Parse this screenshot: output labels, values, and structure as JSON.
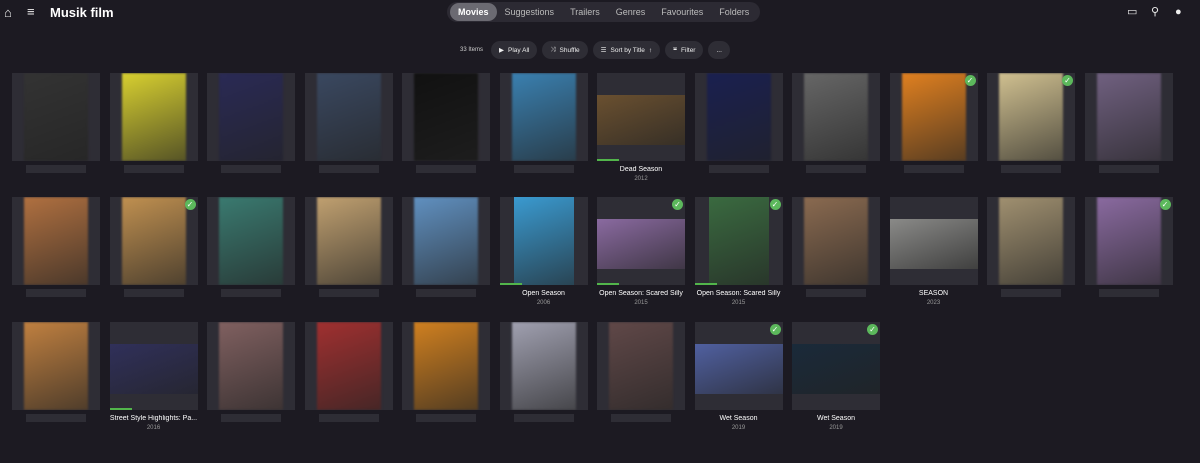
{
  "header": {
    "title": "Musik film",
    "tabs": [
      "Movies",
      "Suggestions",
      "Trailers",
      "Genres",
      "Favourites",
      "Folders"
    ],
    "active_tab": "Movies"
  },
  "toolbar": {
    "count": "33 Items",
    "play_all": "Play All",
    "shuffle": "Shuffle",
    "sort": "Sort by Title",
    "filter": "Filter",
    "more": "..."
  },
  "accent": "#52b54b",
  "rows": [
    [
      {
        "c": "#333"
      },
      {
        "c": "#d8d030"
      },
      {
        "c": "#2a2a55"
      },
      {
        "c": "#3a4860"
      },
      {
        "c": "#111"
      },
      {
        "c": "#3a80b0"
      },
      {
        "title": "Dead Season",
        "year": "2012",
        "shape": "land",
        "c": "#6a5030",
        "progress": true
      },
      {
        "c": "#1a2050"
      },
      {
        "c": "#666"
      },
      {
        "c": "#e08020",
        "check": true
      },
      {
        "c": "#d0c090",
        "check": true
      },
      {
        "c": "#706080"
      }
    ],
    [
      {
        "c": "#b07040"
      },
      {
        "c": "#c09050",
        "check": true
      },
      {
        "c": "#3a7a70"
      },
      {
        "c": "#c0a070"
      },
      {
        "c": "#6090c0"
      },
      {
        "title": "Open Season",
        "year": "2006",
        "shape": "poster",
        "c": "#3a9ad0",
        "progress": true
      },
      {
        "title": "Open Season: Scared Silly",
        "year": "2015",
        "shape": "land",
        "c": "#8a6aa0",
        "check": true,
        "progress": true
      },
      {
        "title": "Open Season: Scared Silly",
        "year": "2015",
        "shape": "poster",
        "c": "#3a6a40",
        "check": true,
        "progress": true
      },
      {
        "c": "#8a6a50"
      },
      {
        "title": "SEASON",
        "year": "2023",
        "shape": "land",
        "c": "#8a8a88"
      },
      {
        "c": "#a09070"
      },
      {
        "c": "#8a6aa0",
        "check": true
      }
    ],
    [
      {
        "c": "#c08040"
      },
      {
        "title": "Street Style Highlights: Pa...",
        "year": "2016",
        "shape": "land",
        "c": "#30305a",
        "progress": true
      },
      {
        "c": "#806060"
      },
      {
        "c": "#a03030"
      },
      {
        "c": "#d08020"
      },
      {
        "c": "#a0a0b0"
      },
      {
        "c": "#604848"
      },
      {
        "title": "Wet Season",
        "year": "2019",
        "shape": "land",
        "c": "#5060a0",
        "check": true
      },
      {
        "title": "Wet Season",
        "year": "2019",
        "shape": "land",
        "c": "#1a2a3a",
        "check": true
      }
    ]
  ]
}
